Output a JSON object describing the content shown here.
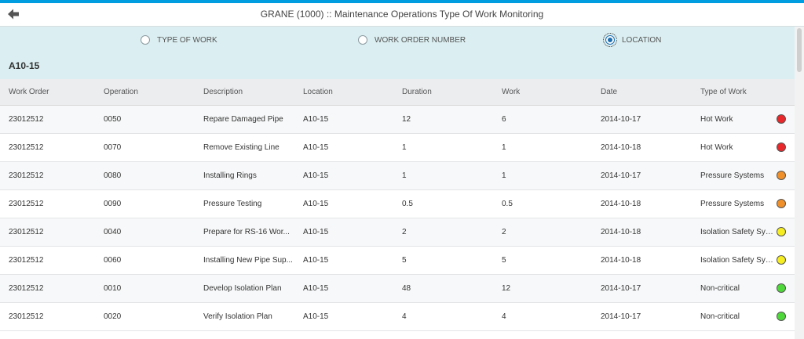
{
  "header": {
    "title": "GRANE (1000) :: Maintenance Operations Type Of Work Monitoring"
  },
  "filter": {
    "options": [
      {
        "label": "TYPE OF WORK",
        "selected": false
      },
      {
        "label": "WORK ORDER NUMBER",
        "selected": false
      },
      {
        "label": "LOCATION",
        "selected": true
      }
    ],
    "location_title": "A10-15"
  },
  "table": {
    "columns": [
      "Work Order",
      "Operation",
      "Description",
      "Location",
      "Duration",
      "Work",
      "Date",
      "Type of Work"
    ],
    "rows": [
      {
        "work_order": "23012512",
        "operation": "0050",
        "description": "Repare Damaged Pipe",
        "location": "A10-15",
        "duration": "12",
        "work": "6",
        "date": "2014-10-17",
        "type_of_work": "Hot Work",
        "status_color": "#e8282b"
      },
      {
        "work_order": "23012512",
        "operation": "0070",
        "description": "Remove Existing Line",
        "location": "A10-15",
        "duration": "1",
        "work": "1",
        "date": "2014-10-18",
        "type_of_work": "Hot Work",
        "status_color": "#e8282b"
      },
      {
        "work_order": "23012512",
        "operation": "0080",
        "description": "Installing Rings",
        "location": "A10-15",
        "duration": "1",
        "work": "1",
        "date": "2014-10-17",
        "type_of_work": "Pressure Systems",
        "status_color": "#f0902a"
      },
      {
        "work_order": "23012512",
        "operation": "0090",
        "description": "Pressure Testing",
        "location": "A10-15",
        "duration": "0.5",
        "work": "0.5",
        "date": "2014-10-18",
        "type_of_work": "Pressure Systems",
        "status_color": "#f0902a"
      },
      {
        "work_order": "23012512",
        "operation": "0040",
        "description": "Prepare for RS-16 Wor...",
        "location": "A10-15",
        "duration": "2",
        "work": "2",
        "date": "2014-10-18",
        "type_of_work": "Isolation Safety Sys...",
        "status_color": "#f6ee22"
      },
      {
        "work_order": "23012512",
        "operation": "0060",
        "description": "Installing New Pipe Sup...",
        "location": "A10-15",
        "duration": "5",
        "work": "5",
        "date": "2014-10-18",
        "type_of_work": "Isolation Safety Sys...",
        "status_color": "#f6ee22"
      },
      {
        "work_order": "23012512",
        "operation": "0010",
        "description": "Develop Isolation Plan",
        "location": "A10-15",
        "duration": "48",
        "work": "12",
        "date": "2014-10-17",
        "type_of_work": "Non-critical",
        "status_color": "#4fd83a"
      },
      {
        "work_order": "23012512",
        "operation": "0020",
        "description": "Verify Isolation Plan",
        "location": "A10-15",
        "duration": "4",
        "work": "4",
        "date": "2014-10-17",
        "type_of_work": "Non-critical",
        "status_color": "#4fd83a"
      }
    ]
  }
}
